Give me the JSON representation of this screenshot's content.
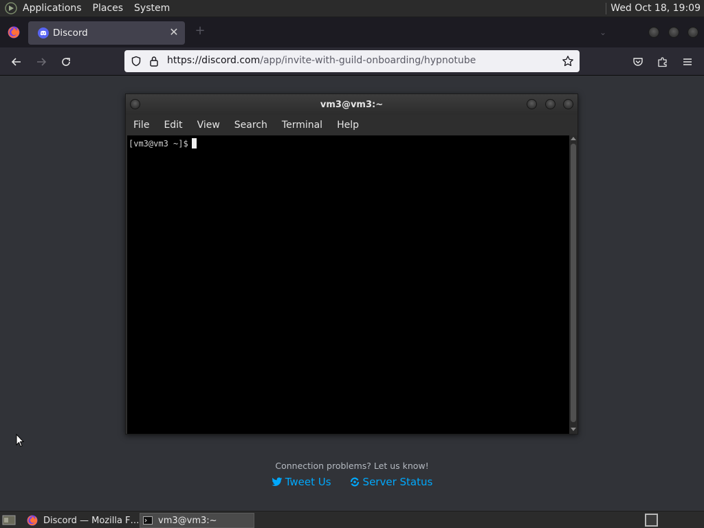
{
  "top_panel": {
    "menus": [
      "Applications",
      "Places",
      "System"
    ],
    "clock": "Wed Oct 18, 19:09"
  },
  "browser": {
    "tab": {
      "title": "Discord",
      "icon": "discord-icon"
    },
    "url": {
      "host": "https://discord.com",
      "path": "/app/invite-with-guild-onboarding/hypnotube"
    }
  },
  "page": {
    "connection_text": "Connection problems? Let us know!",
    "tweet_label": "Tweet Us",
    "status_label": "Server Status"
  },
  "terminal": {
    "title": "vm3@vm3:~",
    "menu": [
      "File",
      "Edit",
      "View",
      "Search",
      "Terminal",
      "Help"
    ],
    "prompt": "[vm3@vm3 ~]$"
  },
  "taskbar": {
    "tasks": [
      {
        "label": "Discord — Mozilla F…",
        "icon": "firefox-icon"
      },
      {
        "label": "vm3@vm3:~",
        "icon": "terminal-icon"
      }
    ]
  },
  "colors": {
    "discord_bg": "#313338",
    "link": "#00a8fc",
    "panel": "#2b2b2b"
  }
}
